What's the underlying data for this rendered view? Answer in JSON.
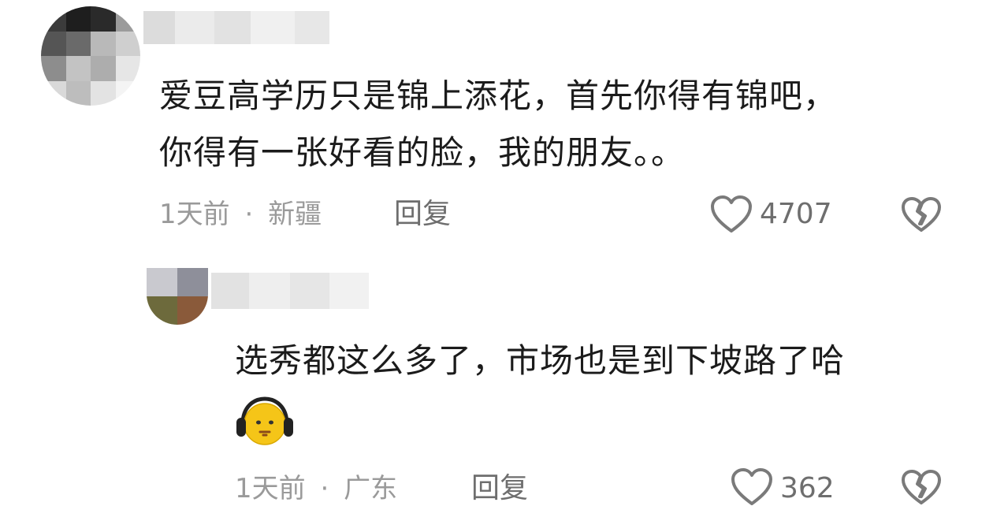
{
  "comments": [
    {
      "text_line1": "爱豆高学历只是锦上添花，首先你得有锦吧，",
      "text_line2": "你得有一张好看的脸，我的朋友。。",
      "time": "1天前",
      "separator": "·",
      "location": "新疆",
      "reply_label": "回复",
      "likes": "4707",
      "like_icon": "heart-outline-icon",
      "dislike_icon": "broken-heart-icon"
    },
    {
      "text": "选秀都这么多了，市场也是到下坡路了哈",
      "emoji": "headphone-face-emoji",
      "time": "1天前",
      "separator": "·",
      "location": "广东",
      "reply_label": "回复",
      "likes": "362",
      "like_icon": "heart-outline-icon",
      "dislike_icon": "broken-heart-icon"
    }
  ],
  "colors": {
    "text": "#1b1b1b",
    "meta": "#9a9a9a",
    "action": "#6e6e6e",
    "icon_stroke": "#7a7a7a"
  }
}
